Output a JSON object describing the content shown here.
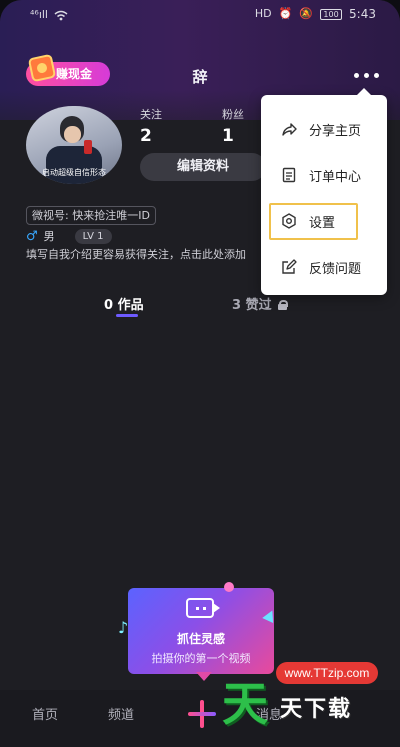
{
  "status_bar": {
    "signal_left": "⁴⁶ıll",
    "wifi": "wifi",
    "icons_right": [
      "HD",
      "⏰",
      "🔕"
    ],
    "battery": "100",
    "time": "5:43"
  },
  "header": {
    "earn_badge": "赚现金",
    "title": "辞"
  },
  "profile": {
    "avatar_caption": "启动超级自信形态",
    "stats": [
      {
        "label": "关注",
        "value": "2"
      },
      {
        "label": "粉丝",
        "value": "1"
      }
    ],
    "edit_button": "编辑资料",
    "wechat_id": "微视号: 快来抢注唯一ID",
    "gender": "男",
    "level": "LV 1",
    "bio": "填写自我介绍更容易获得关注，点击此处添加"
  },
  "tabs": [
    {
      "label": "0 作品"
    },
    {
      "label": "3 赞过"
    }
  ],
  "dropdown_menu": {
    "items": [
      {
        "label": "分享主页",
        "icon": "share-icon"
      },
      {
        "label": "订单中心",
        "icon": "order-icon"
      },
      {
        "label": "设置",
        "icon": "settings-icon"
      },
      {
        "label": "反馈问题",
        "icon": "feedback-icon"
      }
    ]
  },
  "promo": {
    "title": "抓住灵感",
    "subtitle": "拍摄你的第一个视频"
  },
  "bottom_nav": {
    "items": [
      {
        "label": "首页"
      },
      {
        "label": "频道"
      },
      {
        "label": "消息"
      }
    ]
  },
  "watermark": {
    "url": "www.TTzip.com",
    "big": "天",
    "small": "天下载"
  },
  "colors": {
    "accent": "#6e5bff",
    "highlight": "#f0c14b",
    "gender_male": "#39a9ff"
  }
}
